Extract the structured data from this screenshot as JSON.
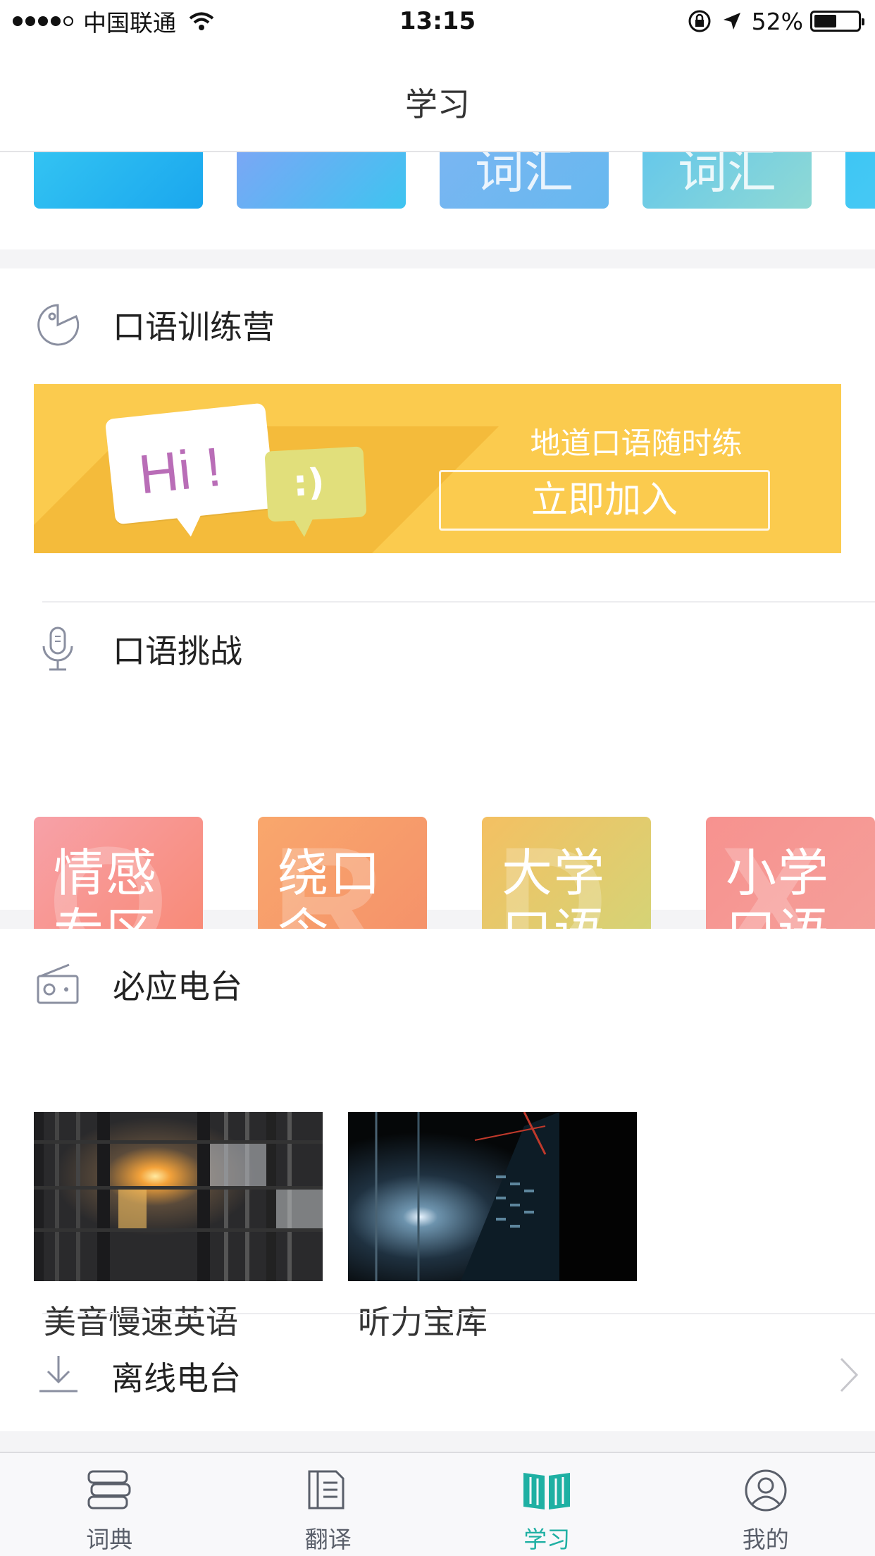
{
  "status_bar": {
    "carrier": "中国联通",
    "time": "13:15",
    "battery": "52%",
    "battery_level": 0.52
  },
  "header": {
    "title": "学习"
  },
  "top_cards": [
    {
      "label": "",
      "colors": [
        "#33c3f2",
        "#1aa7ee"
      ]
    },
    {
      "label": "",
      "colors": [
        "#7aa7f5",
        "#3ec4f0"
      ]
    },
    {
      "label": "词汇",
      "colors": [
        "#79b6f2",
        "#67b8ef"
      ]
    },
    {
      "label": "词汇",
      "colors": [
        "#66c8ea",
        "#8fd9d4"
      ]
    },
    {
      "label": "",
      "colors": [
        "#3ec6f4",
        "#53cdf3"
      ]
    }
  ],
  "speaking_camp": {
    "title": "口语训练营",
    "banner": {
      "hi_text": "Hi !",
      "face_text": ":)",
      "slogan": "地道口语随时练",
      "button": "立即加入",
      "color": "#fbcb4e"
    }
  },
  "speaking_challenge": {
    "title": "口语挑战",
    "cards": [
      {
        "line1": "情感",
        "line2": "专区",
        "letter": "Q",
        "colors": [
          "#f7a1a8",
          "#f9866e"
        ]
      },
      {
        "line1": "绕口",
        "line2": "令",
        "letter": "R",
        "colors": [
          "#f9a76c",
          "#f48e6a"
        ]
      },
      {
        "line1": "大学",
        "line2": "口语",
        "letter": "D",
        "colors": [
          "#f4c062",
          "#cfd77a"
        ]
      },
      {
        "line1": "小学",
        "line2": "口语",
        "letter": "X",
        "colors": [
          "#f7928f",
          "#f4a19b"
        ]
      }
    ]
  },
  "radio": {
    "title": "必应电台",
    "items": [
      {
        "label": "美音慢速英语"
      },
      {
        "label": "听力宝库"
      }
    ],
    "offline": "离线电台"
  },
  "tabs": [
    {
      "label": "词典",
      "icon": "dictionary-icon",
      "active": false
    },
    {
      "label": "翻译",
      "icon": "translate-icon",
      "active": false
    },
    {
      "label": "学习",
      "icon": "book-icon",
      "active": true
    },
    {
      "label": "我的",
      "icon": "profile-icon",
      "active": false
    }
  ],
  "accent_color": "#1fb0a3"
}
